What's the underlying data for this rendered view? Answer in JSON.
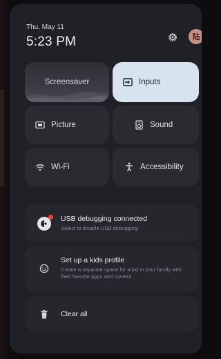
{
  "status": {
    "date": "Thu, May 11",
    "time": "5:23 PM",
    "avatar_initial": "陆"
  },
  "tiles": {
    "screensaver": "Screensaver",
    "inputs": "Inputs",
    "picture": "Picture",
    "sound": "Sound",
    "wifi": "Wi-Fi",
    "accessibility": "Accessibility"
  },
  "notifications": {
    "usb": {
      "title": "USB debugging connected",
      "subtitle": "Select to disable USB debugging."
    },
    "kids": {
      "title": "Set up a kids profile",
      "subtitle": "Create a separate space for a kid in your family with their favorite apps and content"
    },
    "clear": {
      "label": "Clear all"
    }
  },
  "icons": {
    "settings": "gear-icon",
    "inputs": "input-icon",
    "picture": "picture-icon",
    "sound": "speaker-icon",
    "wifi": "wifi-icon",
    "accessibility": "accessibility-icon",
    "usb": "usb-debug-icon",
    "kids": "kids-face-icon",
    "clear": "trash-icon"
  },
  "colors": {
    "accent_tile": "#d7e3ee",
    "panel": "#202126",
    "notification_dot": "#f4413a"
  }
}
